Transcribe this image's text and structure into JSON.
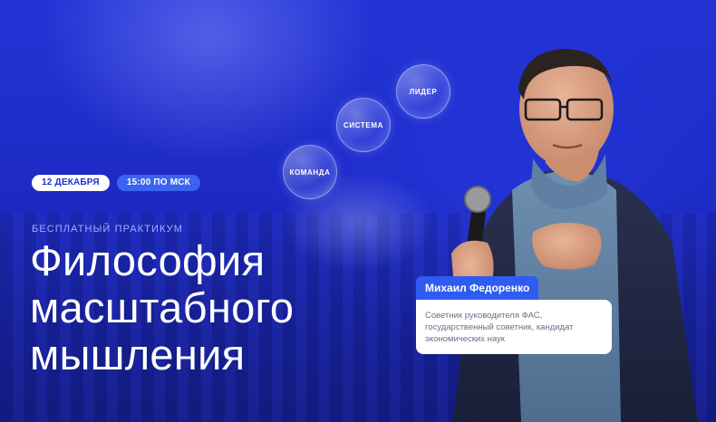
{
  "event": {
    "date": "12 ДЕКАБРЯ",
    "time": "15:00 ПО МСК",
    "subtitle": "БЕСПЛАТНЫЙ ПРАКТИКУМ",
    "title_lines": [
      "Философия",
      "масштабного",
      "мышления"
    ]
  },
  "orbs": [
    "ЛИДЕР",
    "СИСТЕМА",
    "КОМАНДА"
  ],
  "speaker": {
    "name": "Михаил Федоренко",
    "description": "Советник руководителя ФАС, государственный советник, кандидат экономических наук"
  },
  "colors": {
    "background": "#1f2fc8",
    "accent": "#2f5cf0",
    "badge_time": "#3b63f0",
    "subtitle": "#9fb0ff"
  }
}
